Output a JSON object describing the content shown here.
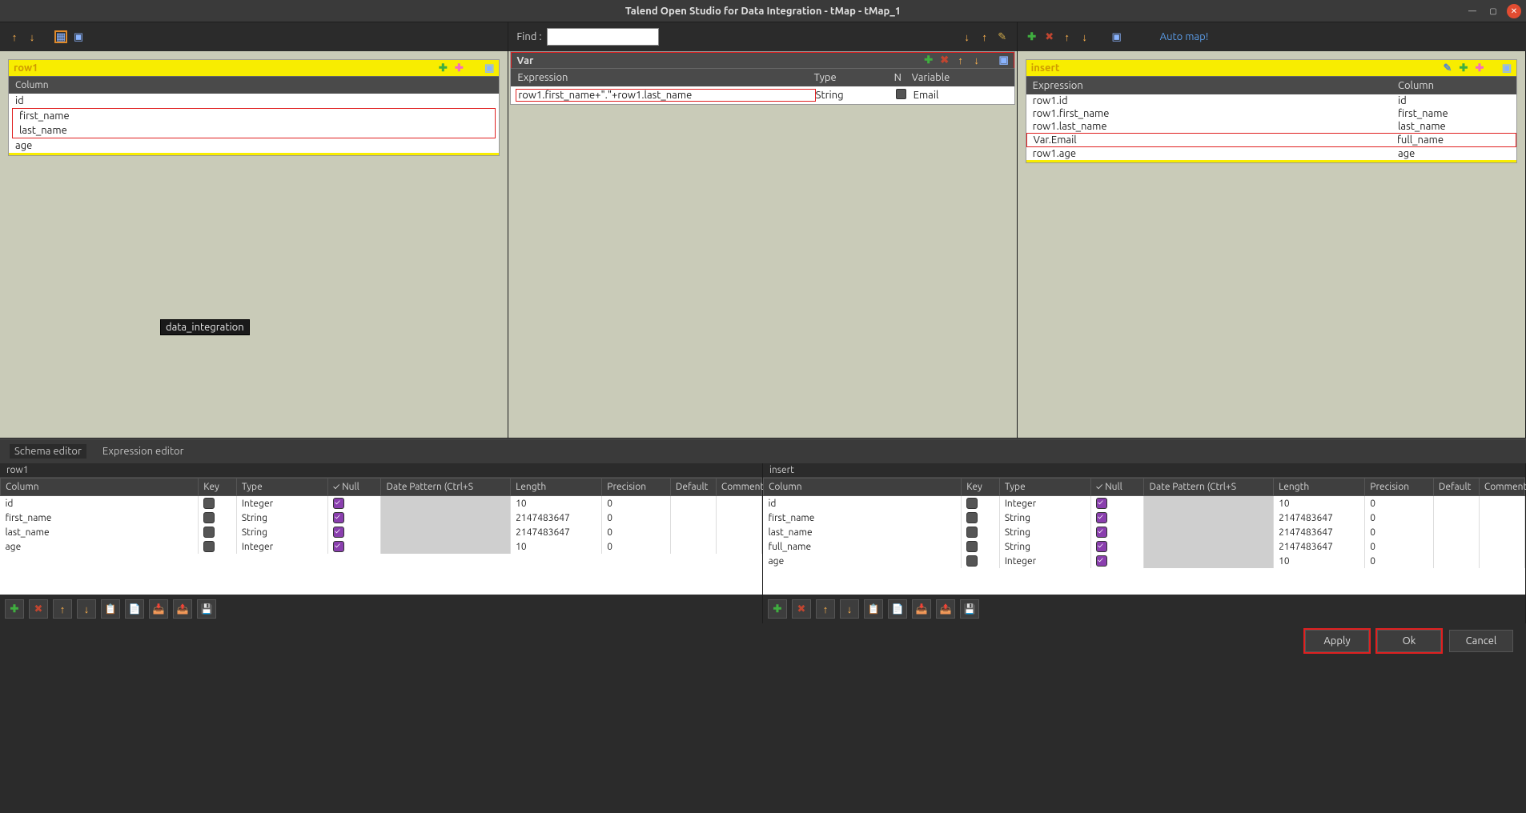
{
  "window": {
    "title": "Talend Open Studio for Data Integration - tMap - tMap_1"
  },
  "find": {
    "label": "Find :",
    "value": ""
  },
  "automap": {
    "label": "Auto map!"
  },
  "badge": {
    "text": "data_integration"
  },
  "left_panel": {
    "name": "row1",
    "header_col": "Column",
    "rows": [
      "id",
      "first_name",
      "last_name",
      "age"
    ]
  },
  "var_panel": {
    "name": "Var",
    "headers": {
      "expression": "Expression",
      "type": "Type",
      "n": "N",
      "variable": "Variable"
    },
    "rows": [
      {
        "expression": "row1.first_name+\".\"+row1.last_name",
        "type": "String",
        "n": false,
        "variable": "Email"
      }
    ]
  },
  "out_panel": {
    "name": "insert",
    "headers": {
      "expression": "Expression",
      "column": "Column"
    },
    "rows": [
      {
        "expression": "row1.id",
        "column": "id",
        "hl": false
      },
      {
        "expression": "row1.first_name",
        "column": "first_name",
        "hl": false
      },
      {
        "expression": "row1.last_name",
        "column": "last_name",
        "hl": false
      },
      {
        "expression": "Var.Email",
        "column": "full_name",
        "hl": true
      },
      {
        "expression": "row1.age",
        "column": "age",
        "hl": false
      }
    ]
  },
  "tabs": {
    "schema": "Schema editor",
    "expression": "Expression editor"
  },
  "schema_left": {
    "name": "row1",
    "headers": [
      "Column",
      "Key",
      "Type",
      "✓ Null",
      "Date Pattern (Ctrl+S",
      "Length",
      "Precision",
      "Default",
      "Comment"
    ],
    "rows": [
      {
        "column": "id",
        "key": false,
        "type": "Integer",
        "null": true,
        "date": "",
        "length": "10",
        "precision": "0",
        "default": "",
        "comment": ""
      },
      {
        "column": "first_name",
        "key": false,
        "type": "String",
        "null": true,
        "date": "",
        "length": "2147483647",
        "precision": "0",
        "default": "",
        "comment": ""
      },
      {
        "column": "last_name",
        "key": false,
        "type": "String",
        "null": true,
        "date": "",
        "length": "2147483647",
        "precision": "0",
        "default": "",
        "comment": ""
      },
      {
        "column": "age",
        "key": false,
        "type": "Integer",
        "null": true,
        "date": "",
        "length": "10",
        "precision": "0",
        "default": "",
        "comment": ""
      }
    ]
  },
  "schema_right": {
    "name": "insert",
    "headers": [
      "Column",
      "Key",
      "Type",
      "✓ Null",
      "Date Pattern (Ctrl+S",
      "Length",
      "Precision",
      "Default",
      "Comment"
    ],
    "rows": [
      {
        "column": "id",
        "key": false,
        "type": "Integer",
        "null": true,
        "date": "",
        "length": "10",
        "precision": "0",
        "default": "",
        "comment": ""
      },
      {
        "column": "first_name",
        "key": false,
        "type": "String",
        "null": true,
        "date": "",
        "length": "2147483647",
        "precision": "0",
        "default": "",
        "comment": ""
      },
      {
        "column": "last_name",
        "key": false,
        "type": "String",
        "null": true,
        "date": "",
        "length": "2147483647",
        "precision": "0",
        "default": "",
        "comment": ""
      },
      {
        "column": "full_name",
        "key": false,
        "type": "String",
        "null": true,
        "date": "",
        "length": "2147483647",
        "precision": "0",
        "default": "",
        "comment": ""
      },
      {
        "column": "age",
        "key": false,
        "type": "Integer",
        "null": true,
        "date": "",
        "length": "10",
        "precision": "0",
        "default": "",
        "comment": ""
      }
    ]
  },
  "footer": {
    "apply": "Apply",
    "ok": "Ok",
    "cancel": "Cancel"
  }
}
